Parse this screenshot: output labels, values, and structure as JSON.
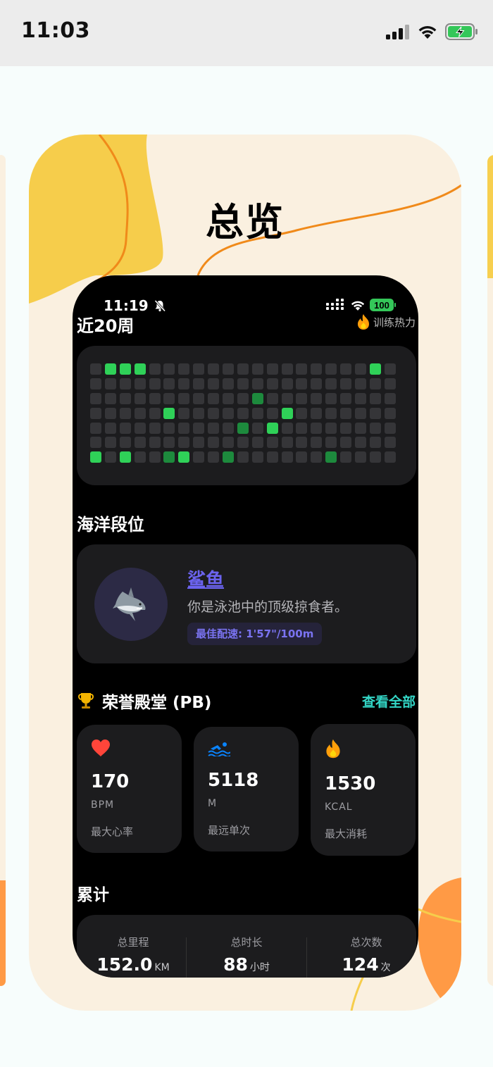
{
  "status_bar": {
    "time": "11:03",
    "battery_color": "#34c759"
  },
  "card": {
    "title": "总览"
  },
  "phone": {
    "status_time": "11:19",
    "battery_level": "100",
    "heatmap_section": {
      "title": "近20周",
      "legend_label": "训练热力"
    },
    "heatmap": {
      "rows": 7,
      "cols": 21,
      "colors": {
        "empty": "#353538",
        "low": "#1d8a3d",
        "high": "#2fd158"
      },
      "levels": [
        [
          0,
          2,
          2,
          2,
          0,
          0,
          0,
          0,
          0,
          0,
          0,
          0,
          0,
          0,
          0,
          0,
          0,
          0,
          0,
          2,
          0
        ],
        [
          0,
          0,
          0,
          0,
          0,
          0,
          0,
          0,
          0,
          0,
          0,
          0,
          0,
          0,
          0,
          0,
          0,
          0,
          0,
          0,
          0
        ],
        [
          0,
          0,
          0,
          0,
          0,
          0,
          0,
          0,
          0,
          0,
          0,
          1,
          0,
          0,
          0,
          0,
          0,
          0,
          0,
          0,
          0
        ],
        [
          0,
          0,
          0,
          0,
          0,
          2,
          0,
          0,
          0,
          0,
          0,
          0,
          0,
          2,
          0,
          0,
          0,
          0,
          0,
          0,
          0
        ],
        [
          0,
          0,
          0,
          0,
          0,
          0,
          0,
          0,
          0,
          0,
          1,
          0,
          2,
          0,
          0,
          0,
          0,
          0,
          0,
          0,
          0
        ],
        [
          0,
          0,
          0,
          0,
          0,
          0,
          0,
          0,
          0,
          0,
          0,
          0,
          0,
          0,
          0,
          0,
          0,
          0,
          0,
          0,
          0
        ],
        [
          2,
          0,
          2,
          0,
          0,
          1,
          2,
          0,
          0,
          1,
          0,
          0,
          0,
          0,
          0,
          0,
          1,
          0,
          0,
          0,
          0
        ]
      ]
    },
    "rank": {
      "section_title": "海洋段位",
      "avatar_icon": "shark-icon",
      "name": "鲨鱼",
      "description": "你是泳池中的顶级掠食者。",
      "best_pace": "最佳配速: 1'57\"/100m"
    },
    "pb": {
      "title": "荣誉殿堂 (PB)",
      "view_all": "查看全部",
      "stats": [
        {
          "icon": "heart-icon",
          "value": "170",
          "unit": "BPM",
          "label": "最大心率"
        },
        {
          "icon": "swimmer-icon",
          "value": "5118",
          "unit": "M",
          "label": "最远单次"
        },
        {
          "icon": "flame-icon",
          "value": "1530",
          "unit": "KCAL",
          "label": "最大消耗"
        }
      ]
    },
    "totals": {
      "title": "累计",
      "items": [
        {
          "label": "总里程",
          "value": "152.0",
          "unit": "KM"
        },
        {
          "label": "总时长",
          "value": "88",
          "unit": "小时"
        },
        {
          "label": "总次数",
          "value": "124",
          "unit": "次"
        }
      ]
    }
  }
}
